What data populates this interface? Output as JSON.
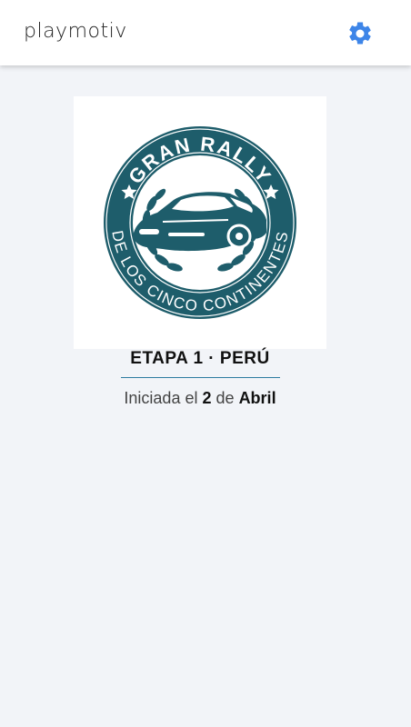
{
  "header": {
    "logo_text": "playmotiv",
    "settings_icon": "gear-icon",
    "accent_color": "#3d85e8"
  },
  "badge": {
    "top_text": "GRAN RALLY",
    "bottom_text": "DE LOS CINCO CONTINENTES",
    "color": "#1e5d6b"
  },
  "stage": {
    "title": "ETAPA 1 · PERÚ",
    "started_prefix": "Iniciada el",
    "day": "2",
    "connector": "de",
    "month": "Abril"
  }
}
